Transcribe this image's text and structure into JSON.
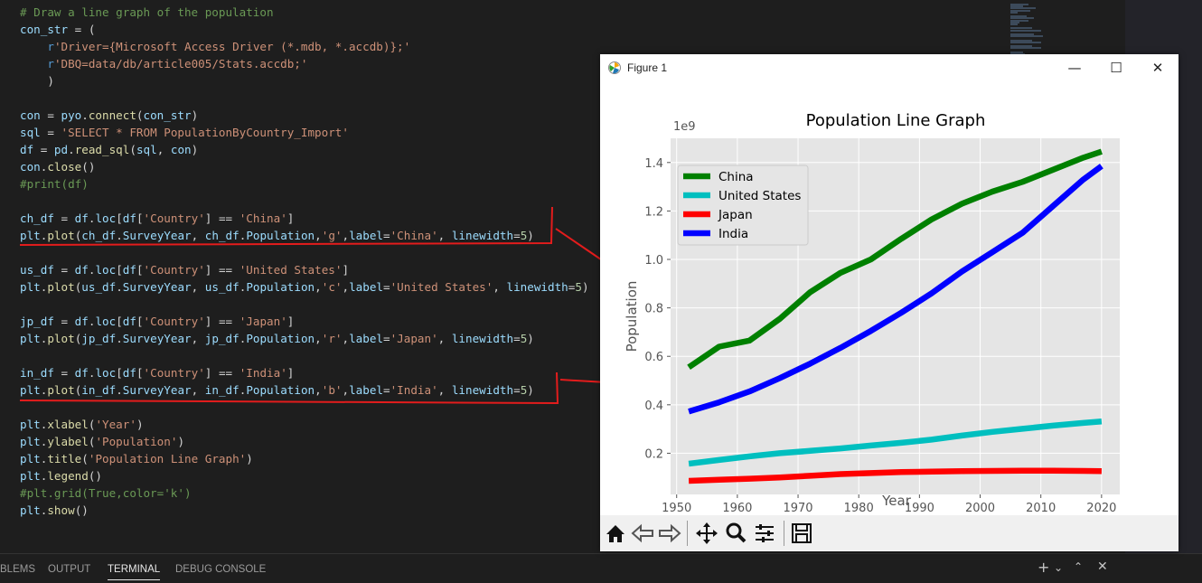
{
  "code_lines": [
    [
      [
        "c-com",
        "# Draw a line graph of the population"
      ]
    ],
    [
      [
        "c-var",
        "con_str"
      ],
      [
        "c-op",
        " = ("
      ]
    ],
    [
      [
        "c-op",
        "    "
      ],
      [
        "c-kw",
        "r"
      ],
      [
        "c-str",
        "'Driver={Microsoft Access Driver (*.mdb, *.accdb)};'"
      ]
    ],
    [
      [
        "c-op",
        "    "
      ],
      [
        "c-kw",
        "r"
      ],
      [
        "c-str",
        "'DBQ=data/db/article005/Stats.accdb;'"
      ]
    ],
    [
      [
        "c-op",
        "    )"
      ]
    ],
    [],
    [
      [
        "c-var",
        "con"
      ],
      [
        "c-op",
        " = "
      ],
      [
        "c-var",
        "pyo"
      ],
      [
        "c-op",
        "."
      ],
      [
        "c-fn",
        "connect"
      ],
      [
        "c-op",
        "("
      ],
      [
        "c-var",
        "con_str"
      ],
      [
        "c-op",
        ")"
      ]
    ],
    [
      [
        "c-var",
        "sql"
      ],
      [
        "c-op",
        " = "
      ],
      [
        "c-str",
        "'SELECT * FROM PopulationByCountry_Import'"
      ]
    ],
    [
      [
        "c-var",
        "df"
      ],
      [
        "c-op",
        " = "
      ],
      [
        "c-var",
        "pd"
      ],
      [
        "c-op",
        "."
      ],
      [
        "c-fn",
        "read_sql"
      ],
      [
        "c-op",
        "("
      ],
      [
        "c-var",
        "sql"
      ],
      [
        "c-op",
        ", "
      ],
      [
        "c-var",
        "con"
      ],
      [
        "c-op",
        ")"
      ]
    ],
    [
      [
        "c-var",
        "con"
      ],
      [
        "c-op",
        "."
      ],
      [
        "c-fn",
        "close"
      ],
      [
        "c-op",
        "()"
      ]
    ],
    [
      [
        "c-com",
        "#print(df)"
      ]
    ],
    [],
    [
      [
        "c-var",
        "ch_df"
      ],
      [
        "c-op",
        " = "
      ],
      [
        "c-var",
        "df"
      ],
      [
        "c-op",
        "."
      ],
      [
        "c-var",
        "loc"
      ],
      [
        "c-op",
        "["
      ],
      [
        "c-var",
        "df"
      ],
      [
        "c-op",
        "["
      ],
      [
        "c-str",
        "'Country'"
      ],
      [
        "c-op",
        "] == "
      ],
      [
        "c-str",
        "'China'"
      ],
      [
        "c-op",
        "]"
      ]
    ],
    [
      [
        "c-var",
        "plt"
      ],
      [
        "c-op",
        "."
      ],
      [
        "c-fn",
        "plot"
      ],
      [
        "c-op",
        "("
      ],
      [
        "c-var",
        "ch_df"
      ],
      [
        "c-op",
        "."
      ],
      [
        "c-var",
        "SurveyYear"
      ],
      [
        "c-op",
        ", "
      ],
      [
        "c-var",
        "ch_df"
      ],
      [
        "c-op",
        "."
      ],
      [
        "c-var",
        "Population"
      ],
      [
        "c-op",
        ","
      ],
      [
        "c-str",
        "'g'"
      ],
      [
        "c-op",
        ","
      ],
      [
        "c-var",
        "label"
      ],
      [
        "c-op",
        "="
      ],
      [
        "c-str",
        "'China'"
      ],
      [
        "c-op",
        ", "
      ],
      [
        "c-var",
        "linewidth"
      ],
      [
        "c-op",
        "="
      ],
      [
        "c-num",
        "5"
      ],
      [
        "c-op",
        ")"
      ]
    ],
    [],
    [
      [
        "c-var",
        "us_df"
      ],
      [
        "c-op",
        " = "
      ],
      [
        "c-var",
        "df"
      ],
      [
        "c-op",
        "."
      ],
      [
        "c-var",
        "loc"
      ],
      [
        "c-op",
        "["
      ],
      [
        "c-var",
        "df"
      ],
      [
        "c-op",
        "["
      ],
      [
        "c-str",
        "'Country'"
      ],
      [
        "c-op",
        "] == "
      ],
      [
        "c-str",
        "'United States'"
      ],
      [
        "c-op",
        "]"
      ]
    ],
    [
      [
        "c-var",
        "plt"
      ],
      [
        "c-op",
        "."
      ],
      [
        "c-fn",
        "plot"
      ],
      [
        "c-op",
        "("
      ],
      [
        "c-var",
        "us_df"
      ],
      [
        "c-op",
        "."
      ],
      [
        "c-var",
        "SurveyYear"
      ],
      [
        "c-op",
        ", "
      ],
      [
        "c-var",
        "us_df"
      ],
      [
        "c-op",
        "."
      ],
      [
        "c-var",
        "Population"
      ],
      [
        "c-op",
        ","
      ],
      [
        "c-str",
        "'c'"
      ],
      [
        "c-op",
        ","
      ],
      [
        "c-var",
        "label"
      ],
      [
        "c-op",
        "="
      ],
      [
        "c-str",
        "'United States'"
      ],
      [
        "c-op",
        ", "
      ],
      [
        "c-var",
        "linewidth"
      ],
      [
        "c-op",
        "="
      ],
      [
        "c-num",
        "5"
      ],
      [
        "c-op",
        ")"
      ]
    ],
    [],
    [
      [
        "c-var",
        "jp_df"
      ],
      [
        "c-op",
        " = "
      ],
      [
        "c-var",
        "df"
      ],
      [
        "c-op",
        "."
      ],
      [
        "c-var",
        "loc"
      ],
      [
        "c-op",
        "["
      ],
      [
        "c-var",
        "df"
      ],
      [
        "c-op",
        "["
      ],
      [
        "c-str",
        "'Country'"
      ],
      [
        "c-op",
        "] == "
      ],
      [
        "c-str",
        "'Japan'"
      ],
      [
        "c-op",
        "]"
      ]
    ],
    [
      [
        "c-var",
        "plt"
      ],
      [
        "c-op",
        "."
      ],
      [
        "c-fn",
        "plot"
      ],
      [
        "c-op",
        "("
      ],
      [
        "c-var",
        "jp_df"
      ],
      [
        "c-op",
        "."
      ],
      [
        "c-var",
        "SurveyYear"
      ],
      [
        "c-op",
        ", "
      ],
      [
        "c-var",
        "jp_df"
      ],
      [
        "c-op",
        "."
      ],
      [
        "c-var",
        "Population"
      ],
      [
        "c-op",
        ","
      ],
      [
        "c-str",
        "'r'"
      ],
      [
        "c-op",
        ","
      ],
      [
        "c-var",
        "label"
      ],
      [
        "c-op",
        "="
      ],
      [
        "c-str",
        "'Japan'"
      ],
      [
        "c-op",
        ", "
      ],
      [
        "c-var",
        "linewidth"
      ],
      [
        "c-op",
        "="
      ],
      [
        "c-num",
        "5"
      ],
      [
        "c-op",
        ")"
      ]
    ],
    [],
    [
      [
        "c-var",
        "in_df"
      ],
      [
        "c-op",
        " = "
      ],
      [
        "c-var",
        "df"
      ],
      [
        "c-op",
        "."
      ],
      [
        "c-var",
        "loc"
      ],
      [
        "c-op",
        "["
      ],
      [
        "c-var",
        "df"
      ],
      [
        "c-op",
        "["
      ],
      [
        "c-str",
        "'Country'"
      ],
      [
        "c-op",
        "] == "
      ],
      [
        "c-str",
        "'India'"
      ],
      [
        "c-op",
        "]"
      ]
    ],
    [
      [
        "c-var",
        "plt"
      ],
      [
        "c-op",
        "."
      ],
      [
        "c-fn",
        "plot"
      ],
      [
        "c-op",
        "("
      ],
      [
        "c-var",
        "in_df"
      ],
      [
        "c-op",
        "."
      ],
      [
        "c-var",
        "SurveyYear"
      ],
      [
        "c-op",
        ", "
      ],
      [
        "c-var",
        "in_df"
      ],
      [
        "c-op",
        "."
      ],
      [
        "c-var",
        "Population"
      ],
      [
        "c-op",
        ","
      ],
      [
        "c-str",
        "'b'"
      ],
      [
        "c-op",
        ","
      ],
      [
        "c-var",
        "label"
      ],
      [
        "c-op",
        "="
      ],
      [
        "c-str",
        "'India'"
      ],
      [
        "c-op",
        ", "
      ],
      [
        "c-var",
        "linewidth"
      ],
      [
        "c-op",
        "="
      ],
      [
        "c-num",
        "5"
      ],
      [
        "c-op",
        ")"
      ]
    ],
    [],
    [
      [
        "c-var",
        "plt"
      ],
      [
        "c-op",
        "."
      ],
      [
        "c-fn",
        "xlabel"
      ],
      [
        "c-op",
        "("
      ],
      [
        "c-str",
        "'Year'"
      ],
      [
        "c-op",
        ")"
      ]
    ],
    [
      [
        "c-var",
        "plt"
      ],
      [
        "c-op",
        "."
      ],
      [
        "c-fn",
        "ylabel"
      ],
      [
        "c-op",
        "("
      ],
      [
        "c-str",
        "'Population'"
      ],
      [
        "c-op",
        ")"
      ]
    ],
    [
      [
        "c-var",
        "plt"
      ],
      [
        "c-op",
        "."
      ],
      [
        "c-fn",
        "title"
      ],
      [
        "c-op",
        "("
      ],
      [
        "c-str",
        "'Population Line Graph'"
      ],
      [
        "c-op",
        ")"
      ]
    ],
    [
      [
        "c-var",
        "plt"
      ],
      [
        "c-op",
        "."
      ],
      [
        "c-fn",
        "legend"
      ],
      [
        "c-op",
        "()"
      ]
    ],
    [
      [
        "c-com",
        "#plt.grid(True,color='k')"
      ]
    ],
    [
      [
        "c-var",
        "plt"
      ],
      [
        "c-op",
        "."
      ],
      [
        "c-fn",
        "show"
      ],
      [
        "c-op",
        "()"
      ]
    ]
  ],
  "panel": {
    "tabs": [
      "BLEMS",
      "OUTPUT",
      "TERMINAL",
      "DEBUG CONSOLE"
    ],
    "active_tab": "TERMINAL",
    "icons": [
      "plus-icon",
      "chevron-down-icon",
      "chevron-up-icon",
      "close-icon"
    ]
  },
  "figure_window": {
    "title": "Figure 1",
    "controls": [
      "minimize-icon",
      "maximize-icon",
      "close-icon"
    ],
    "toolbar": [
      "home-icon",
      "back-icon",
      "forward-icon",
      "pan-icon",
      "zoom-icon",
      "configure-icon",
      "save-icon"
    ]
  },
  "annotations": {
    "color": "#e31c1c"
  },
  "chart_data": {
    "type": "line",
    "title": "Population Line Graph",
    "xlabel": "Year",
    "ylabel": "Population",
    "y_offset_label": "1e9",
    "xlim": [
      1949,
      2023
    ],
    "ylim": [
      0.03,
      1.5
    ],
    "x_ticks": [
      1950,
      1960,
      1970,
      1980,
      1990,
      2000,
      2010,
      2020
    ],
    "x_tick_labels": [
      "1950",
      "1960",
      "1970",
      "1980",
      "1990",
      "2000",
      "2010",
      "2020"
    ],
    "y_ticks": [
      0.2,
      0.4,
      0.6,
      0.8,
      1.0,
      1.2,
      1.4
    ],
    "y_tick_labels": [
      "0.2",
      "0.4",
      "0.6",
      "0.8",
      "1.0",
      "1.2",
      "1.4"
    ],
    "grid": true,
    "legend_position": "top-left",
    "series": [
      {
        "name": "China",
        "color": "#008000",
        "x": [
          1952,
          1957,
          1962,
          1967,
          1972,
          1977,
          1982,
          1987,
          1992,
          1997,
          2002,
          2007,
          2012,
          2017,
          2020
        ],
        "y": [
          0.555,
          0.64,
          0.665,
          0.755,
          0.865,
          0.945,
          1.0,
          1.085,
          1.165,
          1.23,
          1.28,
          1.32,
          1.37,
          1.42,
          1.445
        ]
      },
      {
        "name": "United States",
        "color": "#00bfbf",
        "x": [
          1952,
          1957,
          1962,
          1967,
          1972,
          1977,
          1982,
          1987,
          1992,
          1997,
          2002,
          2007,
          2012,
          2017,
          2020
        ],
        "y": [
          0.157,
          0.172,
          0.187,
          0.2,
          0.21,
          0.22,
          0.232,
          0.243,
          0.256,
          0.273,
          0.288,
          0.301,
          0.314,
          0.325,
          0.331
        ]
      },
      {
        "name": "Japan",
        "color": "#ff0000",
        "x": [
          1952,
          1957,
          1962,
          1967,
          1972,
          1977,
          1982,
          1987,
          1992,
          1997,
          2002,
          2007,
          2012,
          2017,
          2020
        ],
        "y": [
          0.086,
          0.091,
          0.095,
          0.1,
          0.107,
          0.114,
          0.118,
          0.122,
          0.124,
          0.126,
          0.127,
          0.128,
          0.128,
          0.127,
          0.126
        ]
      },
      {
        "name": "India",
        "color": "#0000ff",
        "x": [
          1952,
          1957,
          1962,
          1967,
          1972,
          1977,
          1982,
          1987,
          1992,
          1997,
          2002,
          2007,
          2012,
          2017,
          2020
        ],
        "y": [
          0.372,
          0.41,
          0.455,
          0.51,
          0.57,
          0.635,
          0.705,
          0.78,
          0.86,
          0.95,
          1.03,
          1.11,
          1.22,
          1.33,
          1.385
        ]
      }
    ]
  }
}
